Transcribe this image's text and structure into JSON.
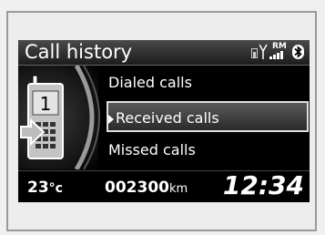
{
  "header": {
    "title": "Call history",
    "roaming_label": "RM",
    "icons": [
      "battery-icon",
      "signal-strength-icon",
      "bluetooth-icon"
    ]
  },
  "side_panel": {
    "phone_line_number": "1",
    "icons": [
      "phone-icon",
      "call-arrow-icon"
    ]
  },
  "menu": {
    "items": [
      {
        "label": "Dialed calls",
        "selected": false
      },
      {
        "label": "Received calls",
        "selected": true
      },
      {
        "label": "Missed calls",
        "selected": false
      }
    ]
  },
  "footer": {
    "temperature_value": "23",
    "temperature_unit": "°c",
    "odometer_value": "002300",
    "odometer_unit": "km",
    "clock": "12:34"
  },
  "colors": {
    "screen_background": "#000000",
    "text": "#ffffff",
    "selection_border": "#e0e0e0"
  }
}
